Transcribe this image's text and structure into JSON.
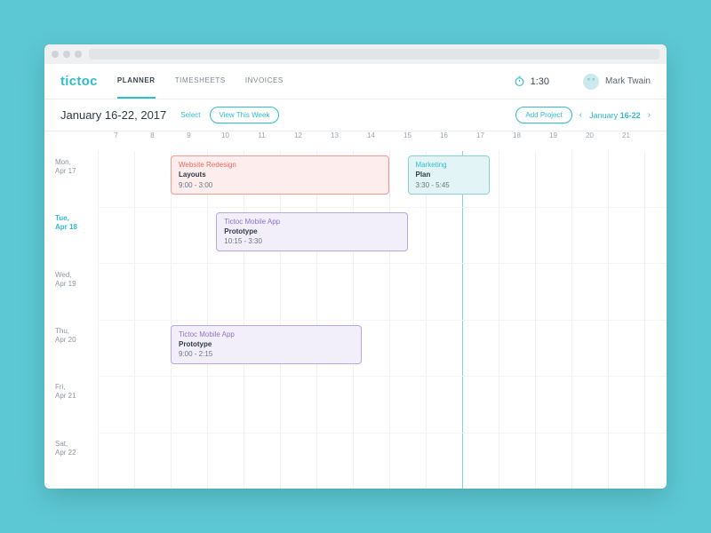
{
  "brand": "tictoc",
  "nav": {
    "tabs": [
      "PLANNER",
      "TIMESHEETS",
      "INVOICES"
    ],
    "active": 0
  },
  "timer": {
    "value": "1:30"
  },
  "user": {
    "name": "Mark Twain",
    "initials": "° °"
  },
  "subbar": {
    "title": "January 16-22, 2017",
    "select": "Select",
    "viewweek": "View This Week",
    "addproject": "Add Project",
    "weeknav": {
      "prefix": "January",
      "range": "16-22"
    }
  },
  "hours": [
    "7",
    "8",
    "9",
    "10",
    "11",
    "12",
    "13",
    "14",
    "15",
    "16",
    "17",
    "18",
    "19",
    "20",
    "21"
  ],
  "days": [
    {
      "label1": "Mon,",
      "label2": "Apr 17",
      "active": false
    },
    {
      "label1": "Tue,",
      "label2": "Apr 18",
      "active": true
    },
    {
      "label1": "Wed,",
      "label2": "Apr 19",
      "active": false
    },
    {
      "label1": "Thu,",
      "label2": "Apr 20",
      "active": false
    },
    {
      "label1": "Fri,",
      "label2": "Apr 21",
      "active": false
    },
    {
      "label1": "Sat,",
      "label2": "Apr 22",
      "active": false
    }
  ],
  "events": [
    {
      "day": 0,
      "startHour": 9,
      "endHour": 15,
      "project": "Website Redesign",
      "task": "Layouts",
      "time": "9:00 - 3:00",
      "color": "red"
    },
    {
      "day": 0,
      "startHour": 15.5,
      "endHour": 17.75,
      "project": "Marketing",
      "task": "Plan",
      "time": "3:30 - 5:45",
      "color": "teal"
    },
    {
      "day": 1,
      "startHour": 10.25,
      "endHour": 15.5,
      "project": "Tictoc Mobile App",
      "task": "Prototype",
      "time": "10:15 - 3:30",
      "color": "purple"
    },
    {
      "day": 3,
      "startHour": 9,
      "endHour": 14.25,
      "project": "Tictoc Mobile App",
      "task": "Prototype",
      "time": "9:00 - 2:15",
      "color": "purple"
    }
  ],
  "nowHour": 17
}
